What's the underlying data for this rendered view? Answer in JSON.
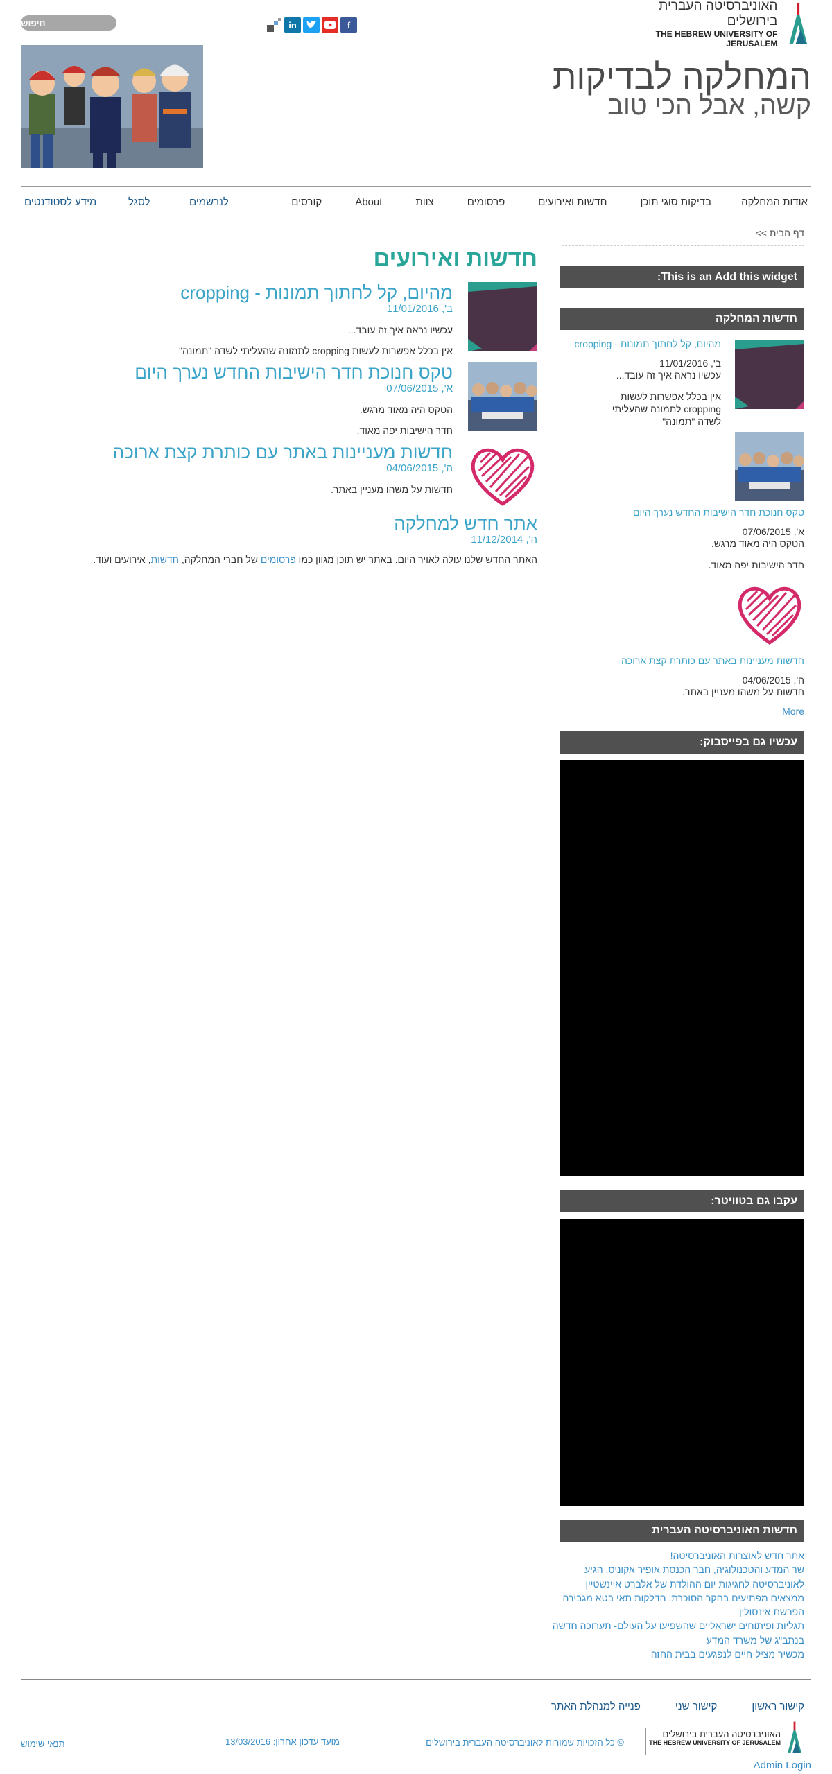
{
  "header": {
    "university_he": "האוניברסיטה העברית בירושלים",
    "university_en": "THE HEBREW UNIVERSITY OF JERUSALEM",
    "site_title": "המחלקה לבדיקות",
    "site_slogan": "קשה, אבל הכי טוב",
    "search_label": "חיפוש",
    "social": [
      "f",
      "yt",
      "in",
      "t"
    ],
    "colors": {
      "facebook": "#3b5998",
      "youtube": "#e52d27",
      "twitter": "#1da1f2",
      "linkedin": "#0e76a8",
      "accent": "#2aa59a",
      "link": "#3aa3c8"
    }
  },
  "main_menu": [
    "אודות המחלקה",
    "בדיקות סוגי תוכן",
    "חדשות ואירועים",
    "פרסומים",
    "צוות",
    "About",
    "קורסים"
  ],
  "secondary_menu": [
    "לנרשמים",
    "לסגל",
    "מידע לסטודנטים"
  ],
  "breadcrumb": "דף הבית >>",
  "page": {
    "title": "חדשות ואירועים",
    "news": [
      {
        "title": "מהיום, קל לחתוך תמונות - cropping",
        "date": "ב', 11/01/2016",
        "text1": "עכשיו נראה איך זה עובד...",
        "text2": "אין בכלל אפשרות לעשות cropping לתמונה שהעליתי לשדה \"תמונה\""
      },
      {
        "title": "טקס חנוכת חדר הישיבות החדש נערך היום",
        "date": "א', 07/06/2015",
        "text1": "הטקס היה מאוד מרגש.",
        "text2": "חדר הישיבות יפה מאוד."
      },
      {
        "title": "חדשות מעניינות באתר עם כותרת קצת ארוכה",
        "date": "ה', 04/06/2015",
        "text1": "חדשות על משהו מעניין באתר.",
        "text2": ""
      },
      {
        "title": "אתר חדש למחלקה",
        "date": "ה', 11/12/2014",
        "text_a": "האתר החדש שלנו עולה לאויר היום. באתר יש תוכן מגוון כמו ",
        "link1": "פרסומים",
        "text_b": " של חברי המחלקה, ",
        "link2": "חדשות",
        "text_c": ", אירועים ועוד."
      }
    ]
  },
  "sidebar": {
    "add_widget": "This is an Add this widget:",
    "dept_news_title": "חדשות המחלקה",
    "dept_news": [
      {
        "title": "מהיום, קל לחתוך תמונות - cropping",
        "date": "ב', 11/01/2016",
        "text1": "עכשיו נראה איך זה עובד...",
        "text2": "אין בכלל אפשרות לעשות cropping לתמונה שהעליתי לשדה \"תמונה\""
      },
      {
        "title": "טקס חנוכת חדר הישיבות החדש נערך היום",
        "date": "א', 07/06/2015",
        "text1": "הטקס היה מאוד מרגש.",
        "text2": "חדר הישיבות יפה מאוד."
      },
      {
        "title": "חדשות מעניינות באתר עם כותרת קצת ארוכה",
        "date": "ה', 04/06/2015",
        "text1": "חדשות על משהו מעניין באתר."
      }
    ],
    "more": "More",
    "facebook_title": "עכשיו גם בפייסבוק:",
    "twitter_title": "עקבו גם בטוויטר:",
    "uni_news_title": "חדשות האוניברסיטה העברית",
    "uni_news": [
      "אתר חדש לאוצרות האוניברסיטה!",
      "שר המדע והטכנולוגיה, חבר הכנסת אופיר אקוניס, הגיע",
      "לאוניברסיטה לחגיגות יום ההולדת של אלברט איינשטיין",
      "ממצאים מפתיעים בחקר הסוכרת: הדלקות תאי בטא מגבירה",
      "הפרשת אינסולין",
      "תגליות ופיתוחים ישראליים שהשפיעו על העולם- תערוכה חדשה",
      "בנתב\"ג של משרד המדע",
      "מכשיר מציל-חיים לנפגעים בבית החזה"
    ]
  },
  "footer": {
    "links": [
      "קישור ראשון",
      "קישור שני",
      "פנייה למנהלת האתר"
    ],
    "university_he": "האוניברסיטה העברית בירושלים",
    "university_en": "THE HEBREW UNIVERSITY OF JERUSALEM",
    "copyright": "© כל הזכויות שמורות לאוניברסיטה העברית בירושלים",
    "updated": "מועד עדכון אחרון: 13/03/2016",
    "terms": "תנאי שימוש",
    "admin_login": "Admin Login"
  }
}
